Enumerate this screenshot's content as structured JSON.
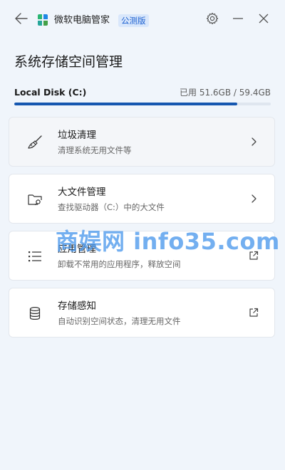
{
  "titlebar": {
    "app_name": "微软电脑管家",
    "edition_badge": "公测版",
    "icons": {
      "back": "arrow-left-icon",
      "logo": "app-logo-icon",
      "settings": "gear-icon",
      "minimize": "minimize-icon",
      "close": "close-icon"
    }
  },
  "page": {
    "title": "系统存储空间管理"
  },
  "disk": {
    "name": "Local Disk (C:)",
    "usage_text": "已用 51.6GB / 59.4GB",
    "used_gb": 51.6,
    "total_gb": 59.4,
    "bar_color": "#1557b0"
  },
  "cards": [
    {
      "title": "垃圾清理",
      "desc": "清理系统无用文件等",
      "icon": "broom-icon",
      "action_icon": "chevron-right-icon"
    },
    {
      "title": "大文件管理",
      "desc": "查找驱动器（C:）中的大文件",
      "icon": "folder-search-icon",
      "action_icon": "chevron-right-icon"
    },
    {
      "title": "应用管理",
      "desc": "卸载不常用的应用程序，释放空间",
      "icon": "list-icon",
      "action_icon": "external-link-icon"
    },
    {
      "title": "存储感知",
      "desc": "自动识别空间状态，清理无用文件",
      "icon": "database-icon",
      "action_icon": "external-link-icon"
    }
  ],
  "watermark": {
    "text": "商娱网 info35.com"
  },
  "colors": {
    "background": "#f0f5fb",
    "accent": "#1557b0",
    "badge_bg": "#d9e7fb",
    "badge_text": "#1a5fd0"
  }
}
